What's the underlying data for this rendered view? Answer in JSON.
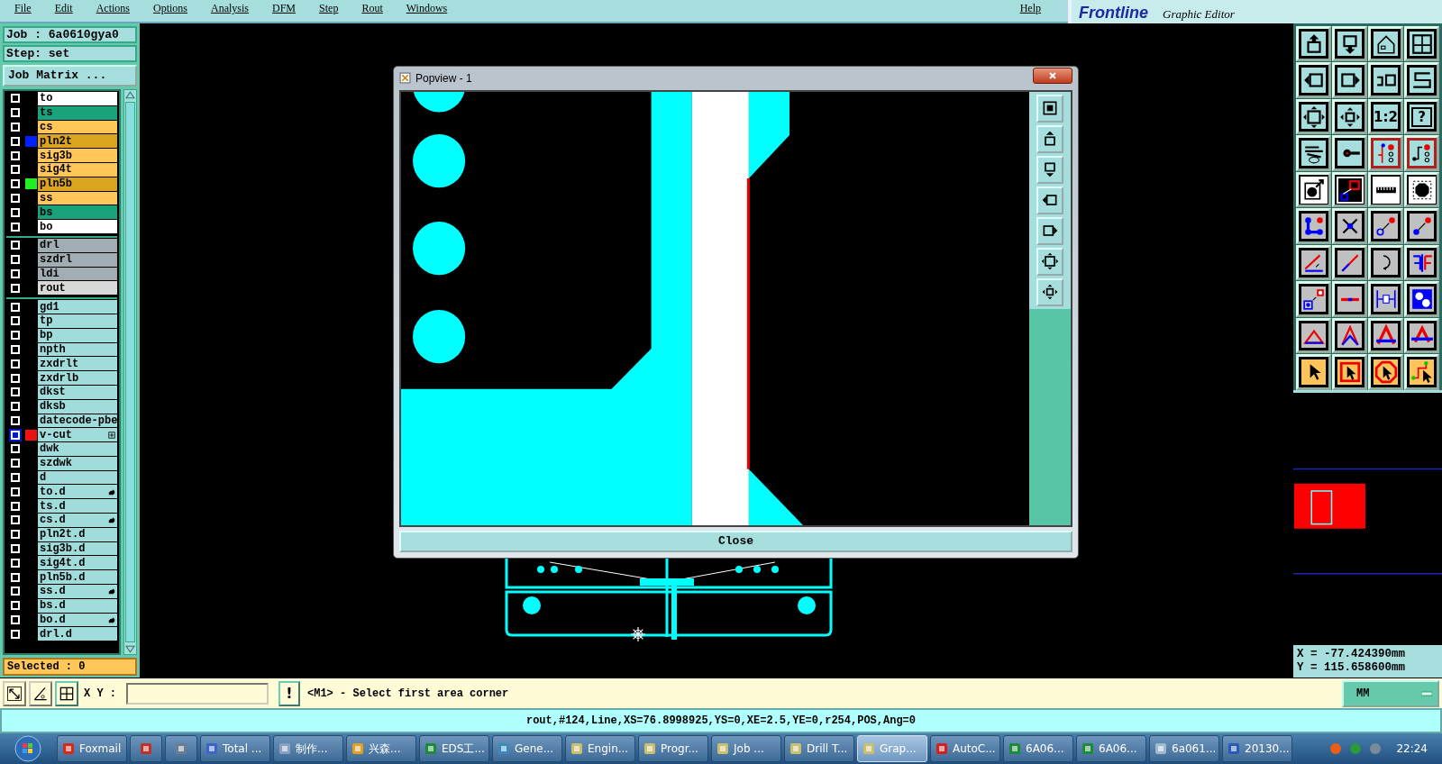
{
  "menu": [
    "File",
    "Edit",
    "Actions",
    "Options",
    "Analysis",
    "DFM",
    "Step",
    "Rout",
    "Windows",
    "Help"
  ],
  "logo": {
    "name": "Frontline",
    "subtitle": "Graphic Editor"
  },
  "job": "Job : 6a0610gya0",
  "step": "Step: set",
  "job_matrix_button": "Job Matrix ...",
  "layer_groups": [
    {
      "layers": [
        {
          "name": "to",
          "color": "#ffffff",
          "kind": "plain",
          "selected": false
        },
        {
          "name": "ts",
          "color": "#1aa37a",
          "kind": "plain",
          "selected": false
        },
        {
          "name": "cs",
          "color": "#ffc65a",
          "kind": "plain",
          "selected": false
        },
        {
          "name": "pln2t",
          "color": "#d9a520",
          "marker": {
            "color": "#0022ff"
          },
          "kind": "plain",
          "selected": false
        },
        {
          "name": "sig3b",
          "color": "#ffc65a",
          "kind": "plain",
          "selected": false
        },
        {
          "name": "sig4t",
          "color": "#ffc65a",
          "kind": "plain",
          "selected": false
        },
        {
          "name": "pln5b",
          "color": "#d9a520",
          "marker": {
            "color": "#22ee22"
          },
          "kind": "plain",
          "selected": false
        },
        {
          "name": "ss",
          "color": "#ffc65a",
          "kind": "plain",
          "selected": false
        },
        {
          "name": "bs",
          "color": "#1aa37a",
          "kind": "plain",
          "selected": false
        },
        {
          "name": "bo",
          "color": "#ffffff",
          "kind": "plain",
          "selected": false
        }
      ]
    },
    {
      "layers": [
        {
          "name": "drl",
          "color": "#a0aeb4",
          "kind": "plain",
          "selected": false
        },
        {
          "name": "szdrl",
          "color": "#a0aeb4",
          "kind": "plain",
          "selected": false
        },
        {
          "name": "ldi",
          "color": "#a0aeb4",
          "kind": "plain",
          "selected": false
        },
        {
          "name": "rout",
          "color": "#d8d8d8",
          "kind": "plain",
          "selected": false
        }
      ]
    },
    {
      "layers": [
        {
          "name": "gd1",
          "color": "#a0dcdc",
          "kind": "plain",
          "selected": false
        },
        {
          "name": "tp",
          "color": "#a0dcdc",
          "kind": "plain",
          "selected": false
        },
        {
          "name": "bp",
          "color": "#a0dcdc",
          "kind": "plain",
          "selected": false
        },
        {
          "name": "npth",
          "color": "#a0dcdc",
          "kind": "plain",
          "selected": false
        },
        {
          "name": "zxdrlt",
          "color": "#a0dcdc",
          "kind": "plain",
          "selected": false
        },
        {
          "name": "zxdrlb",
          "color": "#a0dcdc",
          "kind": "plain",
          "selected": false
        },
        {
          "name": "dkst",
          "color": "#a0dcdc",
          "kind": "plain",
          "selected": false
        },
        {
          "name": "dksb",
          "color": "#a0dcdc",
          "kind": "plain",
          "selected": false
        },
        {
          "name": "datecode-pbe",
          "color": "#a0dcdc",
          "kind": "plain",
          "selected": false
        },
        {
          "name": "v-cut",
          "color": "#a0dcdc",
          "marker": {
            "color": "#ee1111"
          },
          "kind": "expand",
          "selected": true
        },
        {
          "name": "dwk",
          "color": "#a0dcdc",
          "kind": "plain",
          "selected": false
        },
        {
          "name": "szdwk",
          "color": "#a0dcdc",
          "kind": "plain",
          "selected": false
        },
        {
          "name": "d",
          "color": "#a0dcdc",
          "kind": "plain",
          "selected": false
        },
        {
          "name": "to.d",
          "color": "#a0dcdc",
          "kind": "hand",
          "selected": false
        },
        {
          "name": "ts.d",
          "color": "#a0dcdc",
          "kind": "plain",
          "selected": false
        },
        {
          "name": "cs.d",
          "color": "#a0dcdc",
          "kind": "hand",
          "selected": false
        },
        {
          "name": "pln2t.d",
          "color": "#a0dcdc",
          "kind": "plain",
          "selected": false
        },
        {
          "name": "sig3b.d",
          "color": "#a0dcdc",
          "kind": "plain",
          "selected": false
        },
        {
          "name": "sig4t.d",
          "color": "#a0dcdc",
          "kind": "plain",
          "selected": false
        },
        {
          "name": "pln5b.d",
          "color": "#a0dcdc",
          "kind": "plain",
          "selected": false
        },
        {
          "name": "ss.d",
          "color": "#a0dcdc",
          "kind": "hand",
          "selected": false
        },
        {
          "name": "bs.d",
          "color": "#a0dcdc",
          "kind": "plain",
          "selected": false
        },
        {
          "name": "bo.d",
          "color": "#a0dcdc",
          "kind": "hand",
          "selected": false
        },
        {
          "name": "drl.d",
          "color": "#a0dcdc",
          "kind": "plain",
          "selected": false
        }
      ]
    }
  ],
  "selected_count": "Selected : 0",
  "popview": {
    "title": "Popview - 1",
    "close_button": "Close"
  },
  "toolbar_labels": {
    "ratio": "1:2",
    "help": "?"
  },
  "coords": {
    "x": "X = -77.424390mm",
    "y": "Y = 115.658600mm"
  },
  "command_bar": {
    "xy_label": "X Y :",
    "confirm_button": "!",
    "message": "<M1> - Select first area corner",
    "units": "MM"
  },
  "status": "rout,#124,Line,XS=76.8998925,YS=0,XE=2.5,YE=0,r254,POS,Ang=0",
  "taskbar": {
    "items": [
      {
        "kind": "app",
        "label": "Foxmail",
        "selected": false
      },
      {
        "kind": "icon",
        "selected": false
      },
      {
        "kind": "icon",
        "selected": false
      },
      {
        "kind": "app",
        "label": "Total ...",
        "selected": false
      },
      {
        "kind": "app",
        "label": "制作...",
        "selected": false
      },
      {
        "kind": "app",
        "label": "兴森...",
        "selected": false
      },
      {
        "kind": "app",
        "label": "EDS工...",
        "selected": false
      },
      {
        "kind": "app",
        "label": "Gene...",
        "selected": false
      },
      {
        "kind": "app",
        "label": "Engin...",
        "selected": false
      },
      {
        "kind": "app",
        "label": "Progr...",
        "selected": false
      },
      {
        "kind": "app",
        "label": "Job ...",
        "selected": false
      },
      {
        "kind": "app",
        "label": "Drill T...",
        "selected": false
      },
      {
        "kind": "app",
        "label": "Grap...",
        "selected": true
      },
      {
        "kind": "app",
        "label": "AutoC...",
        "selected": false
      },
      {
        "kind": "app",
        "label": "6A06...",
        "selected": false
      },
      {
        "kind": "app",
        "label": "6A06...",
        "selected": false
      },
      {
        "kind": "app",
        "label": "6a061...",
        "selected": false
      },
      {
        "kind": "app",
        "label": "20130...",
        "selected": false
      }
    ],
    "clock": "22:24"
  }
}
